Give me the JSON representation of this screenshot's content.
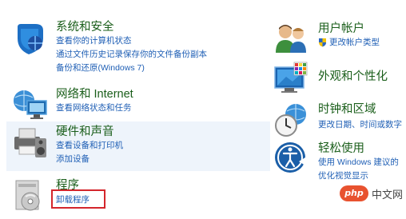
{
  "left": [
    {
      "title": "系统和安全",
      "icon": "shield-icon",
      "links": [
        "查看你的计算机状态",
        "通过文件历史记录保存你的文件备份副本",
        "备份和还原(Windows 7)"
      ]
    },
    {
      "title": "网络和 Internet",
      "icon": "network-globe-icon",
      "links": [
        "查看网络状态和任务"
      ]
    },
    {
      "title": "硬件和声音",
      "icon": "printer-speaker-icon",
      "links": [
        "查看设备和打印机",
        "添加设备"
      ]
    },
    {
      "title": "程序",
      "icon": "programs-disc-icon",
      "links": [
        "卸载程序"
      ]
    }
  ],
  "right": [
    {
      "title": "用户帐户",
      "icon": "users-icon",
      "links": [
        "更改帐户类型"
      ]
    },
    {
      "title": "外观和个性化",
      "icon": "monitor-palette-icon",
      "links": []
    },
    {
      "title": "时钟和区域",
      "icon": "clock-globe-icon",
      "links": [
        "更改日期、时间或数字"
      ]
    },
    {
      "title": "轻松使用",
      "icon": "ease-of-access-icon",
      "links": [
        "使用 Windows 建议的",
        "优化视觉显示"
      ]
    }
  ],
  "watermark": {
    "logo": "php",
    "text": "中文网"
  },
  "colors": {
    "title": "#1a5e1a",
    "link": "#1f5fb5",
    "highlight": "#d4262c"
  }
}
